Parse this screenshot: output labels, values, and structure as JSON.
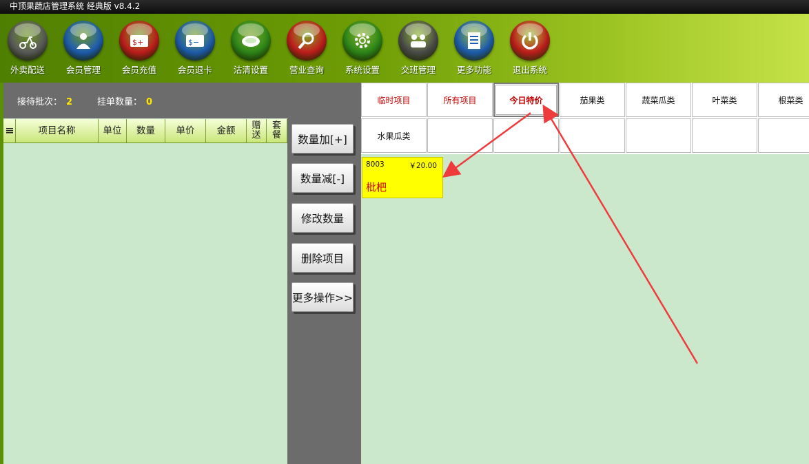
{
  "app": {
    "title": "中顶果蔬店管理系统 经典版 v8.4.2"
  },
  "toolbar": [
    {
      "label": "外卖配送",
      "icon": "scooter-icon",
      "color": "#5c5c5c"
    },
    {
      "label": "会员管理",
      "icon": "person-icon",
      "color": "#1e5fb5"
    },
    {
      "label": "会员充值",
      "icon": "card-plus-icon",
      "color": "#c51d1d"
    },
    {
      "label": "会员退卡",
      "icon": "card-minus-icon",
      "color": "#1e5fb5"
    },
    {
      "label": "沽清设置",
      "icon": "plate-icon",
      "color": "#2f8a1a"
    },
    {
      "label": "营业查询",
      "icon": "search-icon",
      "color": "#c51d1d"
    },
    {
      "label": "系统设置",
      "icon": "gear-icon",
      "color": "#2f8a1a"
    },
    {
      "label": "交班管理",
      "icon": "people-icon",
      "color": "#4d4d4d"
    },
    {
      "label": "更多功能",
      "icon": "list-icon",
      "color": "#1e5fb5"
    },
    {
      "label": "退出系统",
      "icon": "power-icon",
      "color": "#c51d1d"
    }
  ],
  "info": {
    "wait_label": "接待批次：",
    "wait_value": "2",
    "hold_label": "挂单数量：",
    "hold_value": "0"
  },
  "grid": {
    "menu_icon": "menu-icon",
    "columns": [
      "项目名称",
      "单位",
      "数量",
      "单价",
      "金额",
      "赠送",
      "套餐"
    ]
  },
  "actions": [
    "数量加[+]",
    "数量减[-]",
    "修改数量",
    "删除项目",
    "更多操作>>"
  ],
  "categories": {
    "row1": [
      "临时项目",
      "所有项目",
      "今日特价",
      "茄果类",
      "蔬菜瓜类",
      "叶菜类",
      "根菜类"
    ],
    "row2": [
      "水果瓜类",
      "",
      "",
      "",
      "",
      "",
      ""
    ]
  },
  "product": {
    "code": "8003",
    "price": "￥20.00",
    "name": "枇杷"
  },
  "colors": {
    "toolbar_green": "#6e9d05",
    "panel_bg": "#cbe8cc",
    "product_bg": "#ffff00",
    "accent_red": "#c00000",
    "annotation_red": "#ee3b3b"
  }
}
